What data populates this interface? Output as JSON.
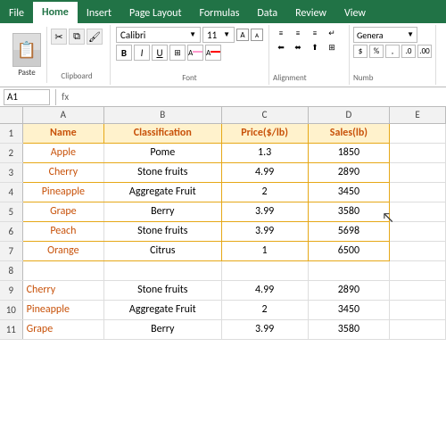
{
  "ribbon": {
    "tabs": [
      "File",
      "Home",
      "Insert",
      "Page Layout",
      "Formulas",
      "Data",
      "Review",
      "View"
    ],
    "active_tab": "Home",
    "font_name": "Calibri",
    "font_size": "11",
    "group_labels": {
      "clipboard": "Clipboard",
      "font": "Font",
      "alignment": "Alignment",
      "number": "Numb"
    },
    "paste_label": "Paste"
  },
  "formula_bar": {
    "name_box": "A1",
    "formula": ""
  },
  "columns": {
    "headers": [
      "A",
      "B",
      "C",
      "D",
      "E"
    ],
    "widths": [
      80,
      115,
      85,
      80,
      55
    ]
  },
  "rows": {
    "header": {
      "row_num": "1",
      "cells": [
        {
          "col": "a",
          "text": "Name",
          "style": "header"
        },
        {
          "col": "b",
          "text": "Classification",
          "style": "header"
        },
        {
          "col": "c",
          "text": "Price($/lb)",
          "style": "header"
        },
        {
          "col": "d",
          "text": "Sales(lb)",
          "style": "header"
        },
        {
          "col": "e",
          "text": "",
          "style": "header"
        }
      ]
    },
    "data": [
      {
        "row_num": "2",
        "cells": [
          "Apple",
          "Pome",
          "1.3",
          "1850"
        ]
      },
      {
        "row_num": "3",
        "cells": [
          "Cherry",
          "Stone fruits",
          "4.99",
          "2890"
        ]
      },
      {
        "row_num": "4",
        "cells": [
          "Pineapple",
          "Aggregate Fruit",
          "2",
          "3450"
        ]
      },
      {
        "row_num": "5",
        "cells": [
          "Grape",
          "Berry",
          "3.99",
          "3580"
        ]
      },
      {
        "row_num": "6",
        "cells": [
          "Peach",
          "Stone fruits",
          "3.99",
          "5698"
        ]
      },
      {
        "row_num": "7",
        "cells": [
          "Orange",
          "Citrus",
          "1",
          "6500"
        ]
      }
    ],
    "empty": [
      {
        "row_num": "8"
      }
    ],
    "below": [
      {
        "row_num": "9",
        "cells": [
          "Cherry",
          "Stone fruits",
          "4.99",
          "2890"
        ]
      },
      {
        "row_num": "10",
        "cells": [
          "Pineapple",
          "Aggregate Fruit",
          "2",
          "3450"
        ]
      },
      {
        "row_num": "11",
        "cells": [
          "Grape",
          "Berry",
          "3.99",
          "3580"
        ]
      }
    ]
  }
}
